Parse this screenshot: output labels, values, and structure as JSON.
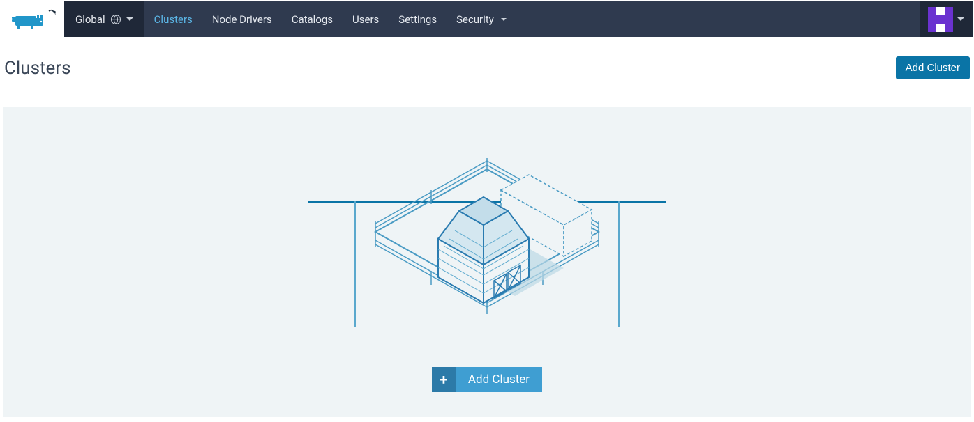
{
  "topbar": {
    "scope_label": "Global",
    "nav": [
      {
        "label": "Clusters",
        "active": true,
        "has_chevron": false
      },
      {
        "label": "Node Drivers",
        "active": false,
        "has_chevron": false
      },
      {
        "label": "Catalogs",
        "active": false,
        "has_chevron": false
      },
      {
        "label": "Users",
        "active": false,
        "has_chevron": false
      },
      {
        "label": "Settings",
        "active": false,
        "has_chevron": false
      },
      {
        "label": "Security",
        "active": false,
        "has_chevron": true
      }
    ]
  },
  "page": {
    "title": "Clusters",
    "add_button": "Add Cluster"
  },
  "empty_state": {
    "add_button": "Add Cluster",
    "plus": "+"
  },
  "colors": {
    "topbar_bg": "#2f3a4f",
    "topbar_dark": "#1f2838",
    "accent": "#5bb6e6",
    "primary": "#0a74a6",
    "primary_light": "#3f9ed2",
    "empty_bg": "#eff4f6",
    "avatar": "#6a32d0"
  }
}
